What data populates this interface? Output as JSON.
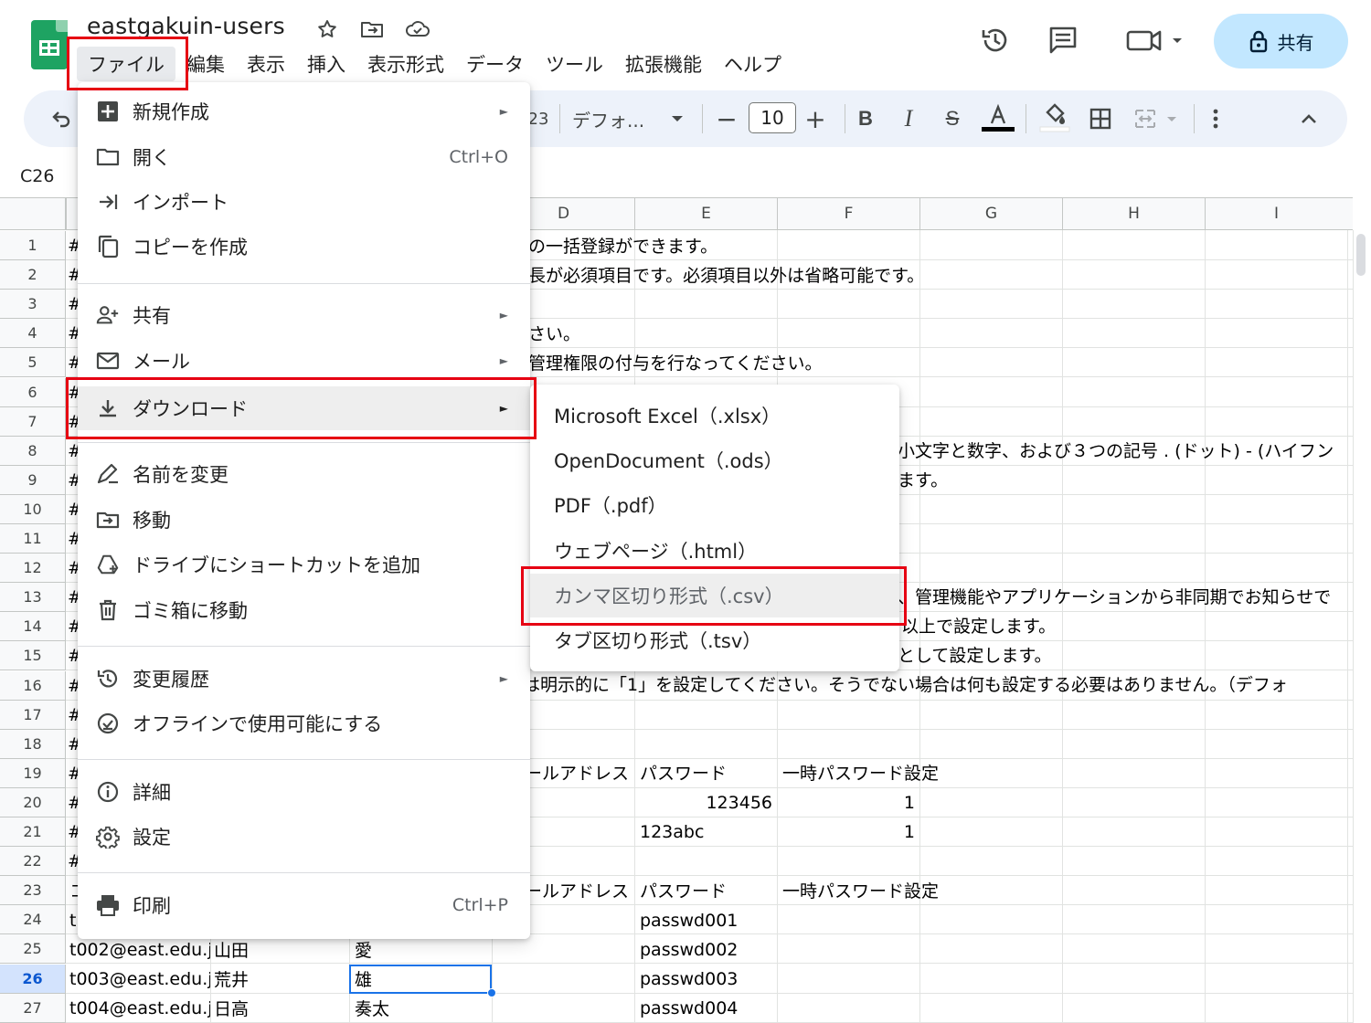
{
  "document": {
    "title": "eastgakuin-users"
  },
  "menubar": {
    "items": [
      "ファイル",
      "編集",
      "表示",
      "挿入",
      "表示形式",
      "データ",
      "ツール",
      "拡張機能",
      "ヘルプ"
    ]
  },
  "header": {
    "share_label": "共有",
    "icons": [
      "star-icon",
      "move-folder-icon",
      "cloud-saved-icon",
      "history-icon",
      "comment-icon",
      "video-call-icon",
      "lock-icon"
    ]
  },
  "toolbar": {
    "font_name": "デフォ...",
    "font_size": "10",
    "partial_format": "23",
    "icons": [
      "undo-icon",
      "decrease-font-icon",
      "increase-font-icon",
      "bold-icon",
      "italic-icon",
      "strikethrough-icon",
      "text-color-icon",
      "fill-color-icon",
      "borders-icon",
      "merge-icon",
      "more-icon",
      "collapse-icon"
    ]
  },
  "namebox": {
    "value": "C26"
  },
  "columns": [
    "D",
    "E",
    "F",
    "G",
    "H",
    "I"
  ],
  "rows": [
    "1",
    "2",
    "3",
    "4",
    "5",
    "6",
    "7",
    "8",
    "9",
    "10",
    "11",
    "12",
    "13",
    "14",
    "15",
    "16",
    "17",
    "18",
    "19",
    "20",
    "21",
    "22",
    "23",
    "24",
    "25",
    "26",
    "27"
  ],
  "selected_row": "26",
  "cells": {
    "r1": "の一括登録ができます。",
    "r2": "長が必須項目です。必須項目以外は省略可能です。",
    "r4": "さい。",
    "r5": "管理権限の付与を行なってください。",
    "r8": "小文字と数字、および３つの記号 . (ドット) - (ハイフン",
    "r9": "ます。",
    "r13": "、管理機能やアプリケーションから非同期でお知らせで",
    "r14": "以上で設定します。",
    "r15": "として設定します。",
    "r16": "は明示的に「1」を設定してください。そうでない場合は何も設定する必要はありません。（デフォ",
    "r19_d": "ールアドレス",
    "r19_e": "パスワード",
    "r19_f": "一時パスワード設定",
    "r20_e": "123456",
    "r20_f": "1",
    "r21_e": "123abc",
    "r21_f": "1",
    "r23_d": "ールアドレス",
    "r23_e": "パスワード",
    "r23_f": "一時パスワード設定",
    "r23_a": "コ",
    "r24_a": "t(",
    "r24_e": "passwd001",
    "r25_a": "t002@east.edu.j",
    "r25_b": "山田",
    "r25_c": "愛",
    "r25_e": "passwd002",
    "r26_a": "t003@east.edu.j",
    "r26_b": "荒井",
    "r26_c": "雄",
    "r26_e": "passwd003",
    "r27_a": "t004@east.edu.j",
    "r27_b": "日高",
    "r27_c": "奏太",
    "r27_e": "passwd004",
    "hash": "#"
  },
  "file_menu": {
    "new": "新規作成",
    "open": "開く",
    "open_shortcut": "Ctrl+O",
    "import": "インポート",
    "copy": "コピーを作成",
    "share": "共有",
    "email": "メール",
    "download": "ダウンロード",
    "rename": "名前を変更",
    "move": "移動",
    "shortcut": "ドライブにショートカットを追加",
    "trash": "ゴミ箱に移動",
    "history": "変更履歴",
    "offline": "オフラインで使用可能にする",
    "details": "詳細",
    "settings": "設定",
    "print": "印刷",
    "print_shortcut": "Ctrl+P"
  },
  "download_submenu": {
    "items": [
      "Microsoft Excel（.xlsx）",
      "OpenDocument（.ods）",
      "PDF（.pdf）",
      "ウェブページ（.html）",
      "カンマ区切り形式（.csv）",
      "タブ区切り形式（.tsv）"
    ],
    "hovered_index": 4
  },
  "colors": {
    "accent": "#1a73e8",
    "share_button": "#c2e7ff",
    "highlight_box": "#e60012",
    "sheets_green": "#1ea362"
  }
}
